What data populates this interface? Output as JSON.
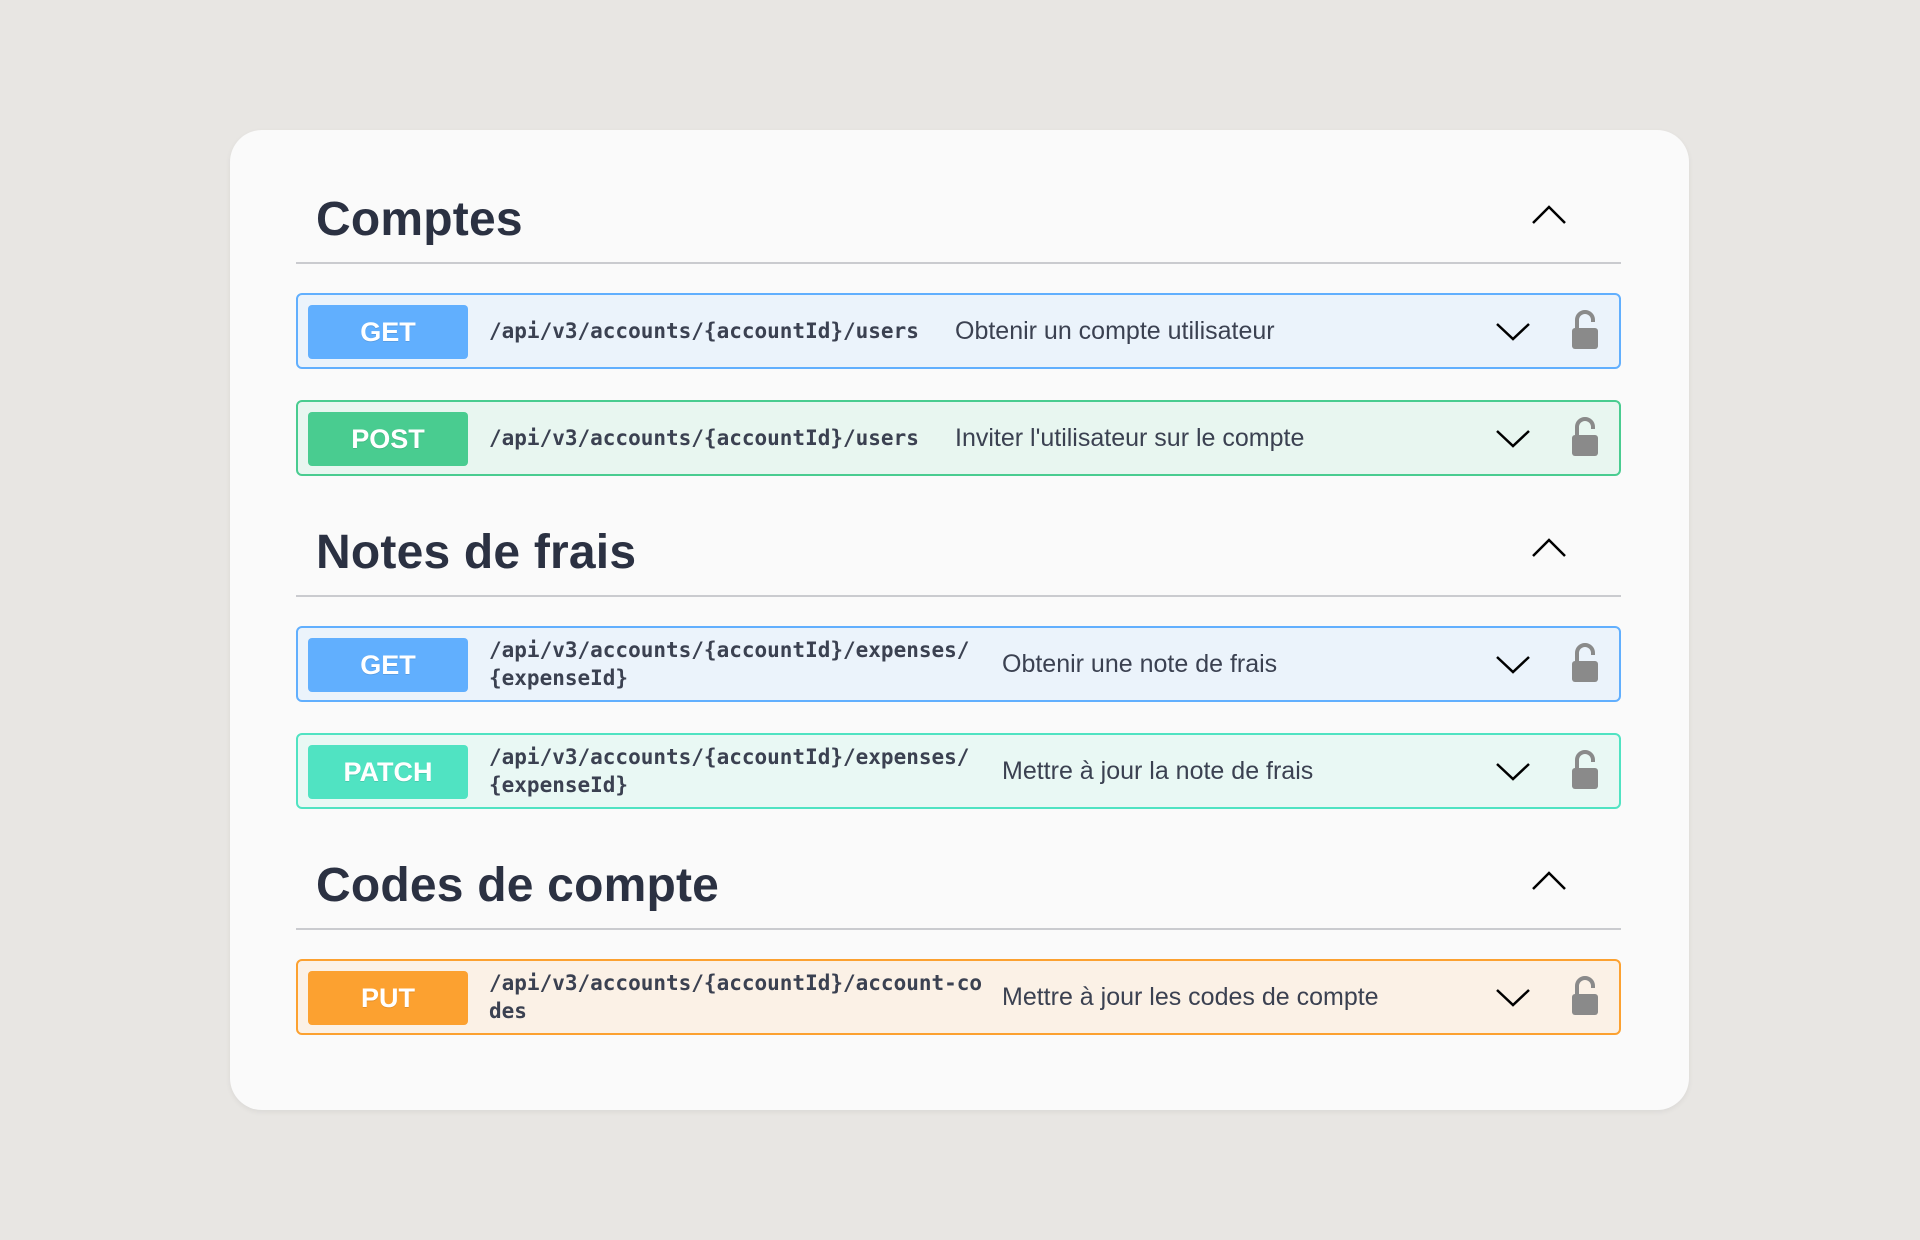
{
  "sections": [
    {
      "title": "Comptes",
      "operations": [
        {
          "method": "GET",
          "path": "/api/v3/accounts/{accountId}/users",
          "summary": "Obtenir un compte utilisateur"
        },
        {
          "method": "POST",
          "path": "/api/v3/accounts/{accountId}/users",
          "summary": "Inviter l'utilisateur sur le compte"
        }
      ]
    },
    {
      "title": "Notes de frais",
      "operations": [
        {
          "method": "GET",
          "path": "/api/v3/accounts/{accountId}/expenses/{expenseId}",
          "summary": "Obtenir une note de frais"
        },
        {
          "method": "PATCH",
          "path": "/api/v3/accounts/{accountId}/expenses/{expenseId}",
          "summary": "Mettre à jour la note de frais"
        }
      ]
    },
    {
      "title": "Codes de compte",
      "operations": [
        {
          "method": "PUT",
          "path": "/api/v3/accounts/{accountId}/account-codes",
          "summary": "Mettre à jour les codes de compte"
        }
      ]
    }
  ],
  "colors": {
    "get": "#61affe",
    "post": "#49cc90",
    "patch": "#50e3c2",
    "put": "#fca130"
  },
  "icons": {
    "section_toggle": "chevron-up-icon",
    "operation_toggle": "chevron-down-icon",
    "auth": "unlocked-padlock-icon"
  }
}
